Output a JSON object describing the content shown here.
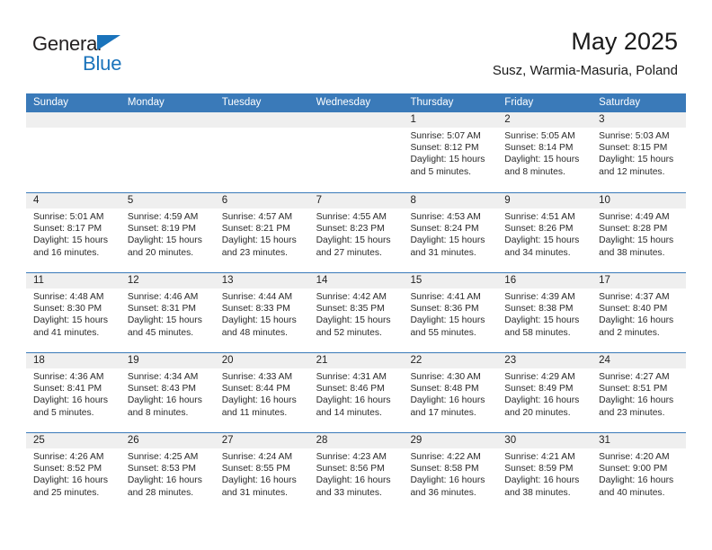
{
  "logo": {
    "word1": "General",
    "word2": "Blue"
  },
  "header": {
    "title": "May 2025",
    "subtitle": "Susz, Warmia-Masuria, Poland"
  },
  "weekday_headers": [
    "Sunday",
    "Monday",
    "Tuesday",
    "Wednesday",
    "Thursday",
    "Friday",
    "Saturday"
  ],
  "colors": {
    "header_blue": "#3a7ab9",
    "date_strip": "#efefef",
    "logo_blue": "#1a73bb",
    "text": "#222222"
  },
  "labels": {
    "sunrise_prefix": "Sunrise: ",
    "sunset_prefix": "Sunset: ",
    "daylight_prefix": "Daylight: "
  },
  "weeks": [
    [
      {
        "date": "",
        "empty": true
      },
      {
        "date": "",
        "empty": true
      },
      {
        "date": "",
        "empty": true
      },
      {
        "date": "",
        "empty": true
      },
      {
        "date": "1",
        "sunrise": "Sunrise: 5:07 AM",
        "sunset": "Sunset: 8:12 PM",
        "daylight": "Daylight: 15 hours and 5 minutes."
      },
      {
        "date": "2",
        "sunrise": "Sunrise: 5:05 AM",
        "sunset": "Sunset: 8:14 PM",
        "daylight": "Daylight: 15 hours and 8 minutes."
      },
      {
        "date": "3",
        "sunrise": "Sunrise: 5:03 AM",
        "sunset": "Sunset: 8:15 PM",
        "daylight": "Daylight: 15 hours and 12 minutes."
      }
    ],
    [
      {
        "date": "4",
        "sunrise": "Sunrise: 5:01 AM",
        "sunset": "Sunset: 8:17 PM",
        "daylight": "Daylight: 15 hours and 16 minutes."
      },
      {
        "date": "5",
        "sunrise": "Sunrise: 4:59 AM",
        "sunset": "Sunset: 8:19 PM",
        "daylight": "Daylight: 15 hours and 20 minutes."
      },
      {
        "date": "6",
        "sunrise": "Sunrise: 4:57 AM",
        "sunset": "Sunset: 8:21 PM",
        "daylight": "Daylight: 15 hours and 23 minutes."
      },
      {
        "date": "7",
        "sunrise": "Sunrise: 4:55 AM",
        "sunset": "Sunset: 8:23 PM",
        "daylight": "Daylight: 15 hours and 27 minutes."
      },
      {
        "date": "8",
        "sunrise": "Sunrise: 4:53 AM",
        "sunset": "Sunset: 8:24 PM",
        "daylight": "Daylight: 15 hours and 31 minutes."
      },
      {
        "date": "9",
        "sunrise": "Sunrise: 4:51 AM",
        "sunset": "Sunset: 8:26 PM",
        "daylight": "Daylight: 15 hours and 34 minutes."
      },
      {
        "date": "10",
        "sunrise": "Sunrise: 4:49 AM",
        "sunset": "Sunset: 8:28 PM",
        "daylight": "Daylight: 15 hours and 38 minutes."
      }
    ],
    [
      {
        "date": "11",
        "sunrise": "Sunrise: 4:48 AM",
        "sunset": "Sunset: 8:30 PM",
        "daylight": "Daylight: 15 hours and 41 minutes."
      },
      {
        "date": "12",
        "sunrise": "Sunrise: 4:46 AM",
        "sunset": "Sunset: 8:31 PM",
        "daylight": "Daylight: 15 hours and 45 minutes."
      },
      {
        "date": "13",
        "sunrise": "Sunrise: 4:44 AM",
        "sunset": "Sunset: 8:33 PM",
        "daylight": "Daylight: 15 hours and 48 minutes."
      },
      {
        "date": "14",
        "sunrise": "Sunrise: 4:42 AM",
        "sunset": "Sunset: 8:35 PM",
        "daylight": "Daylight: 15 hours and 52 minutes."
      },
      {
        "date": "15",
        "sunrise": "Sunrise: 4:41 AM",
        "sunset": "Sunset: 8:36 PM",
        "daylight": "Daylight: 15 hours and 55 minutes."
      },
      {
        "date": "16",
        "sunrise": "Sunrise: 4:39 AM",
        "sunset": "Sunset: 8:38 PM",
        "daylight": "Daylight: 15 hours and 58 minutes."
      },
      {
        "date": "17",
        "sunrise": "Sunrise: 4:37 AM",
        "sunset": "Sunset: 8:40 PM",
        "daylight": "Daylight: 16 hours and 2 minutes."
      }
    ],
    [
      {
        "date": "18",
        "sunrise": "Sunrise: 4:36 AM",
        "sunset": "Sunset: 8:41 PM",
        "daylight": "Daylight: 16 hours and 5 minutes."
      },
      {
        "date": "19",
        "sunrise": "Sunrise: 4:34 AM",
        "sunset": "Sunset: 8:43 PM",
        "daylight": "Daylight: 16 hours and 8 minutes."
      },
      {
        "date": "20",
        "sunrise": "Sunrise: 4:33 AM",
        "sunset": "Sunset: 8:44 PM",
        "daylight": "Daylight: 16 hours and 11 minutes."
      },
      {
        "date": "21",
        "sunrise": "Sunrise: 4:31 AM",
        "sunset": "Sunset: 8:46 PM",
        "daylight": "Daylight: 16 hours and 14 minutes."
      },
      {
        "date": "22",
        "sunrise": "Sunrise: 4:30 AM",
        "sunset": "Sunset: 8:48 PM",
        "daylight": "Daylight: 16 hours and 17 minutes."
      },
      {
        "date": "23",
        "sunrise": "Sunrise: 4:29 AM",
        "sunset": "Sunset: 8:49 PM",
        "daylight": "Daylight: 16 hours and 20 minutes."
      },
      {
        "date": "24",
        "sunrise": "Sunrise: 4:27 AM",
        "sunset": "Sunset: 8:51 PM",
        "daylight": "Daylight: 16 hours and 23 minutes."
      }
    ],
    [
      {
        "date": "25",
        "sunrise": "Sunrise: 4:26 AM",
        "sunset": "Sunset: 8:52 PM",
        "daylight": "Daylight: 16 hours and 25 minutes."
      },
      {
        "date": "26",
        "sunrise": "Sunrise: 4:25 AM",
        "sunset": "Sunset: 8:53 PM",
        "daylight": "Daylight: 16 hours and 28 minutes."
      },
      {
        "date": "27",
        "sunrise": "Sunrise: 4:24 AM",
        "sunset": "Sunset: 8:55 PM",
        "daylight": "Daylight: 16 hours and 31 minutes."
      },
      {
        "date": "28",
        "sunrise": "Sunrise: 4:23 AM",
        "sunset": "Sunset: 8:56 PM",
        "daylight": "Daylight: 16 hours and 33 minutes."
      },
      {
        "date": "29",
        "sunrise": "Sunrise: 4:22 AM",
        "sunset": "Sunset: 8:58 PM",
        "daylight": "Daylight: 16 hours and 36 minutes."
      },
      {
        "date": "30",
        "sunrise": "Sunrise: 4:21 AM",
        "sunset": "Sunset: 8:59 PM",
        "daylight": "Daylight: 16 hours and 38 minutes."
      },
      {
        "date": "31",
        "sunrise": "Sunrise: 4:20 AM",
        "sunset": "Sunset: 9:00 PM",
        "daylight": "Daylight: 16 hours and 40 minutes."
      }
    ]
  ]
}
